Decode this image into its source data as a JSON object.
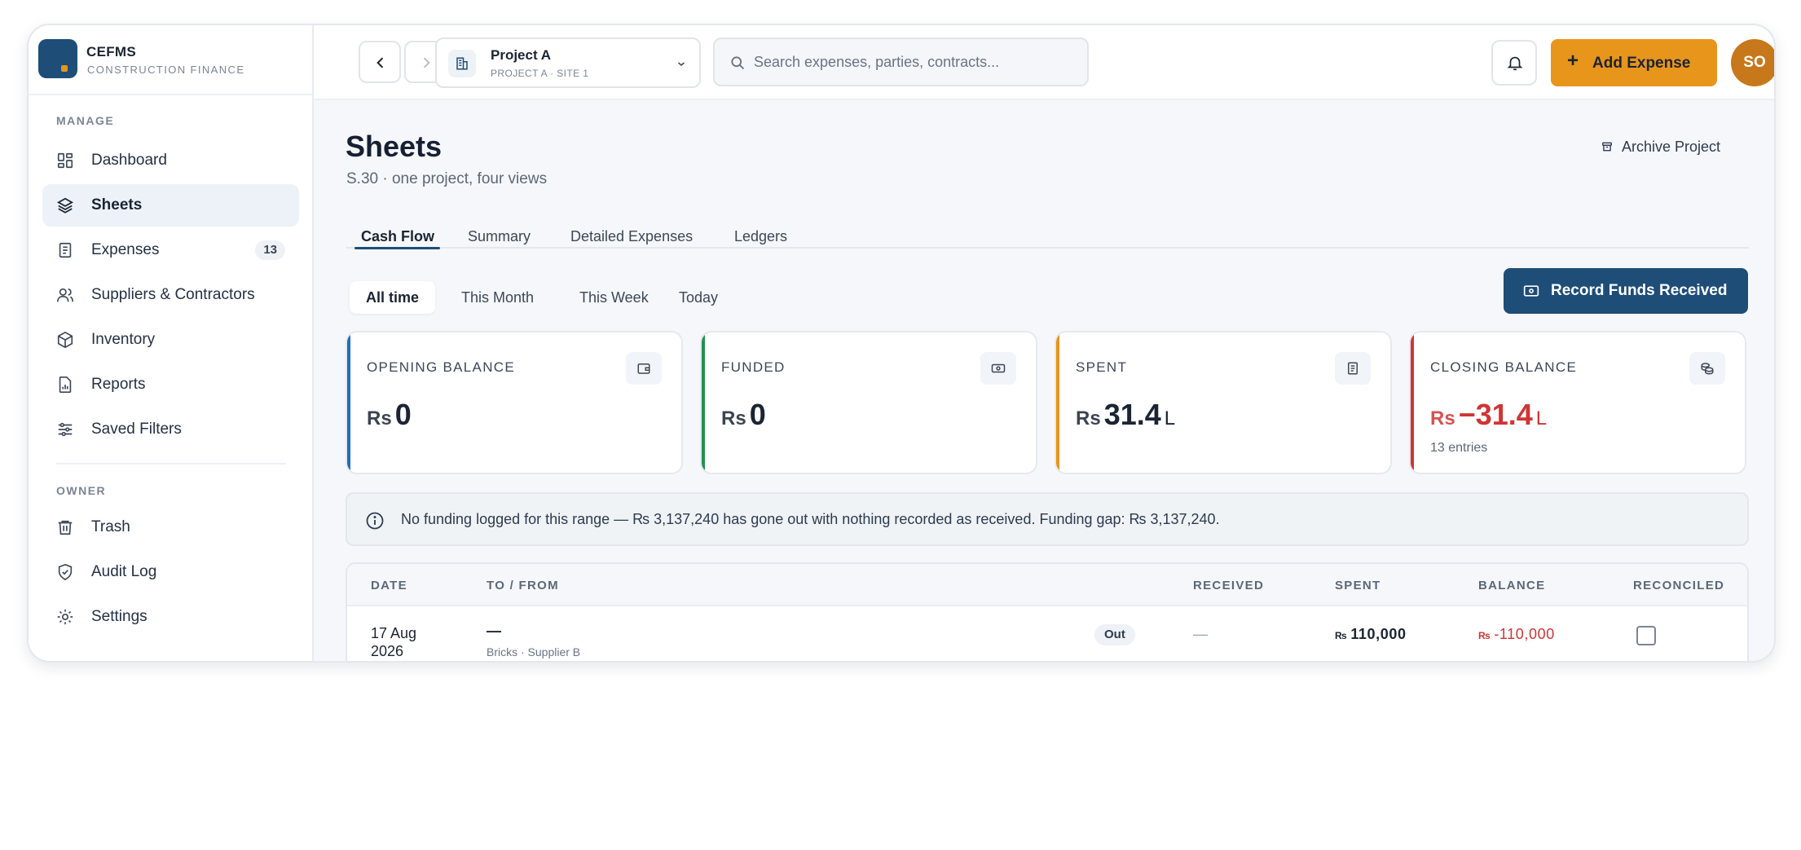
{
  "brand": {
    "name": "CEFMS",
    "subtitle": "CONSTRUCTION FINANCE"
  },
  "sidebar": {
    "manage_label": "MANAGE",
    "owner_label": "OWNER",
    "items": [
      {
        "label": "Dashboard",
        "icon": "dashboard-icon"
      },
      {
        "label": "Sheets",
        "icon": "layers-icon",
        "active": true
      },
      {
        "label": "Expenses",
        "icon": "receipt-icon",
        "count": "13"
      },
      {
        "label": "Suppliers & Contractors",
        "icon": "users-icon"
      },
      {
        "label": "Inventory",
        "icon": "box-icon"
      },
      {
        "label": "Reports",
        "icon": "report-icon"
      },
      {
        "label": "Saved Filters",
        "icon": "sliders-icon"
      },
      {
        "label": "Trash",
        "icon": "trash-icon"
      },
      {
        "label": "Audit Log",
        "icon": "shield-check-icon"
      },
      {
        "label": "Settings",
        "icon": "gear-icon"
      }
    ]
  },
  "topbar": {
    "project": {
      "name": "Project A",
      "sub": "PROJECT A · SITE 1"
    },
    "search": {
      "placeholder": "Search expenses, parties, contracts...",
      "value": ""
    },
    "add_expense_label": "Add Expense",
    "avatar_initials": "SO"
  },
  "page": {
    "title": "Sheets",
    "subtitle": "S.30 · one project, four views",
    "archive_label": "Archive Project",
    "tabs": [
      "Cash Flow",
      "Summary",
      "Detailed Expenses",
      "Ledgers"
    ],
    "active_tab": "Cash Flow",
    "filters": [
      "All time",
      "This Month",
      "This Week",
      "Today"
    ],
    "active_filter": "All time",
    "record_funds_label": "Record Funds Received"
  },
  "cards": [
    {
      "label": "OPENING BALANCE",
      "currency": "Rs",
      "value": "0",
      "unit": "",
      "accent": "#1e6fb8",
      "icon": "wallet-icon"
    },
    {
      "label": "FUNDED",
      "currency": "Rs",
      "value": "0",
      "unit": "",
      "accent": "#23914e",
      "icon": "banknote-icon"
    },
    {
      "label": "SPENT",
      "currency": "Rs",
      "value": "31.4",
      "unit": "L",
      "accent": "#e8951c",
      "icon": "receipt-icon"
    },
    {
      "label": "CLOSING BALANCE",
      "currency": "Rs",
      "value": "−31.4",
      "unit": "L",
      "accent": "#d03434",
      "icon": "coins-icon",
      "footer": "13 entries"
    }
  ],
  "notice": "No funding logged for this range — ₨ 3,137,240 has gone out with nothing recorded as received. Funding gap: ₨ 3,137,240.",
  "table": {
    "columns": [
      "DATE",
      "TO / FROM",
      "RECEIVED",
      "SPENT",
      "BALANCE",
      "RECONCILED"
    ],
    "rows": [
      {
        "date_line1": "17 Aug",
        "date_line2": "2026",
        "to": "—",
        "to_sub": "Bricks · Supplier B",
        "direction": "Out",
        "received": "—",
        "spent_currency": "₨",
        "spent": "110,000",
        "balance_currency": "₨",
        "balance": "-110,000",
        "reconciled": false
      }
    ]
  },
  "colors": {
    "primary": "#1e4d78",
    "accent": "#e8951c",
    "negative": "#d03434",
    "avatar": "#c7781a"
  }
}
